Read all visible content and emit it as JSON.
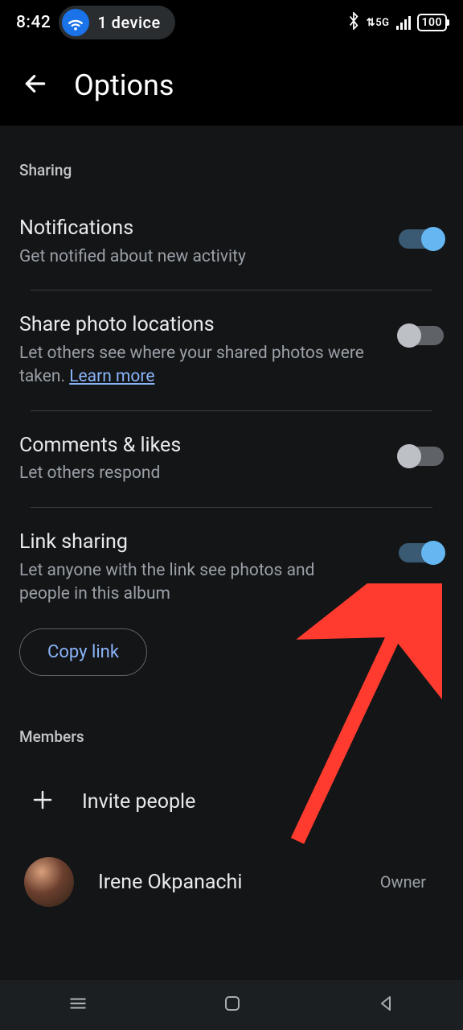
{
  "statusbar": {
    "time": "8:42",
    "device_pill": "1 device",
    "network_label": "5G",
    "battery": "100"
  },
  "header": {
    "title": "Options"
  },
  "sections": {
    "sharing_header": "Sharing",
    "members_header": "Members"
  },
  "settings": {
    "notifications": {
      "label": "Notifications",
      "desc": "Get notified about new activity",
      "on": true
    },
    "share_locations": {
      "label": "Share photo locations",
      "desc": "Let others see where your shared photos were taken. ",
      "learn_more": "Learn more",
      "on": false
    },
    "comments_likes": {
      "label": "Comments & likes",
      "desc": "Let others respond",
      "on": false
    },
    "link_sharing": {
      "label": "Link sharing",
      "desc": "Let anyone with the link see photos and people in this album",
      "on": true
    }
  },
  "buttons": {
    "copy_link": "Copy link",
    "invite_people": "Invite people"
  },
  "members": [
    {
      "name": "Irene Okpanachi",
      "role": "Owner"
    }
  ],
  "colors": {
    "accent": "#8ab4f8",
    "toggle_on": "#66b6f1",
    "annotation_arrow": "#ff3b2f"
  }
}
